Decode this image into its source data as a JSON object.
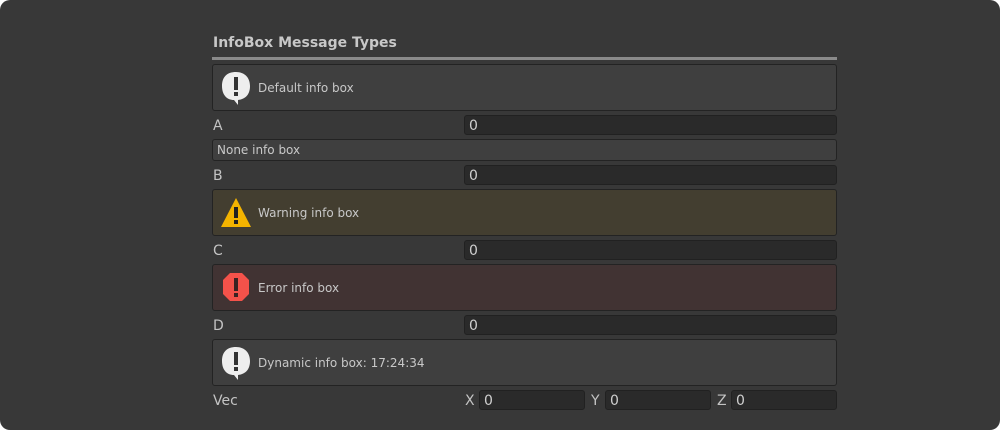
{
  "section_title": "InfoBox Message Types",
  "boxes": {
    "default": "Default info box",
    "none": "None info box",
    "warning": "Warning info box",
    "error": "Error info box",
    "dynamic": "Dynamic info box: 17:24:34"
  },
  "fields": [
    {
      "label": "A",
      "value": "0"
    },
    {
      "label": "B",
      "value": "0"
    },
    {
      "label": "C",
      "value": "0"
    },
    {
      "label": "D",
      "value": "0"
    }
  ],
  "vec": {
    "label": "Vec",
    "x_label": "X",
    "x": "0",
    "y_label": "Y",
    "y": "0",
    "z_label": "Z",
    "z": "0"
  },
  "colors": {
    "warning": "#f4b400",
    "error": "#f4524a",
    "info": "#eeeeee"
  }
}
